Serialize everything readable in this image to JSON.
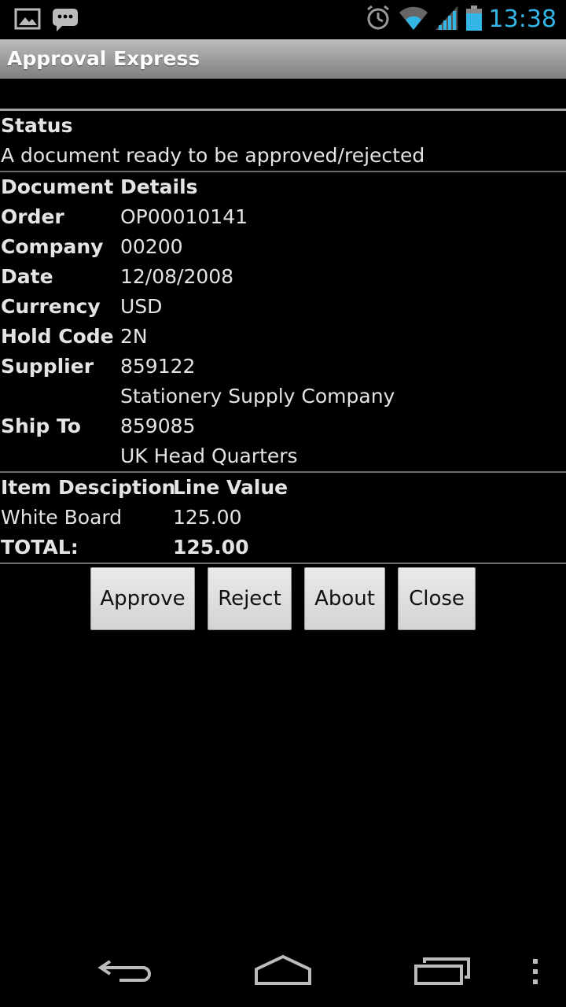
{
  "status_bar": {
    "time": "13:38",
    "icons": [
      "picture-icon",
      "chat-icon",
      "alarm-icon",
      "wifi-icon",
      "signal-icon",
      "battery-icon"
    ],
    "accent_color": "#33b5e5"
  },
  "app": {
    "title": "Approval Express"
  },
  "status": {
    "heading": "Status",
    "text": "A document ready to be approved/rejected"
  },
  "details": {
    "heading": "Document Details",
    "rows": [
      {
        "label": "Order",
        "value": "OP00010141"
      },
      {
        "label": "Company",
        "value": "00200"
      },
      {
        "label": "Date",
        "value": "12/08/2008"
      },
      {
        "label": "Currency",
        "value": "USD"
      },
      {
        "label": "Hold Code",
        "value": "2N"
      },
      {
        "label": "Supplier",
        "value": "859122"
      },
      {
        "label": "",
        "value": "Stationery Supply Company"
      },
      {
        "label": "Ship To",
        "value": "859085"
      },
      {
        "label": "",
        "value": "UK Head Quarters"
      }
    ]
  },
  "items": {
    "headers": [
      "Item Desciption",
      "Line Value"
    ],
    "rows": [
      {
        "description": "White Board",
        "value": "125.00"
      }
    ],
    "total_label": "TOTAL:",
    "total_value": "125.00"
  },
  "buttons": {
    "approve": "Approve",
    "reject": "Reject",
    "about": "About",
    "close": "Close"
  },
  "nav_bar": {
    "icons": [
      "back-icon",
      "home-icon",
      "recent-apps-icon",
      "overflow-menu-icon"
    ]
  }
}
